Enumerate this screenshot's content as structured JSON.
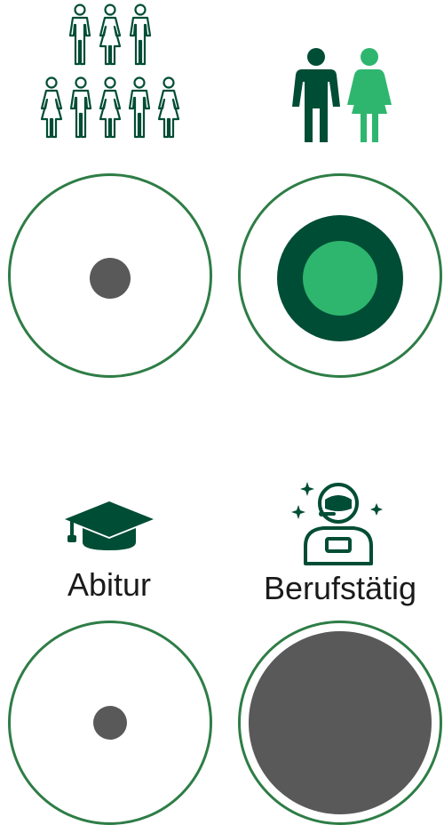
{
  "colors": {
    "dark_green": "#004d35",
    "accent_green": "#2eb66f",
    "ring_green": "#2e7d46",
    "grey": "#595959"
  },
  "icons": {
    "group": "crowd-icon",
    "couple": "man-woman-icon",
    "education": "graduation-cap-icon",
    "occupation": "astronaut-icon"
  },
  "labels": {
    "education": "Abitur",
    "occupation": "Berufstätig"
  },
  "circles": [
    {
      "name": "group-small-dot",
      "fill_fraction": 0.2
    },
    {
      "name": "couple-nested-dots",
      "outer_fraction": 0.63,
      "inner_fraction": 0.37
    },
    {
      "name": "abitur-small-dot",
      "fill_fraction": 0.17
    },
    {
      "name": "beruf-large-dot",
      "fill_fraction": 0.93
    }
  ]
}
